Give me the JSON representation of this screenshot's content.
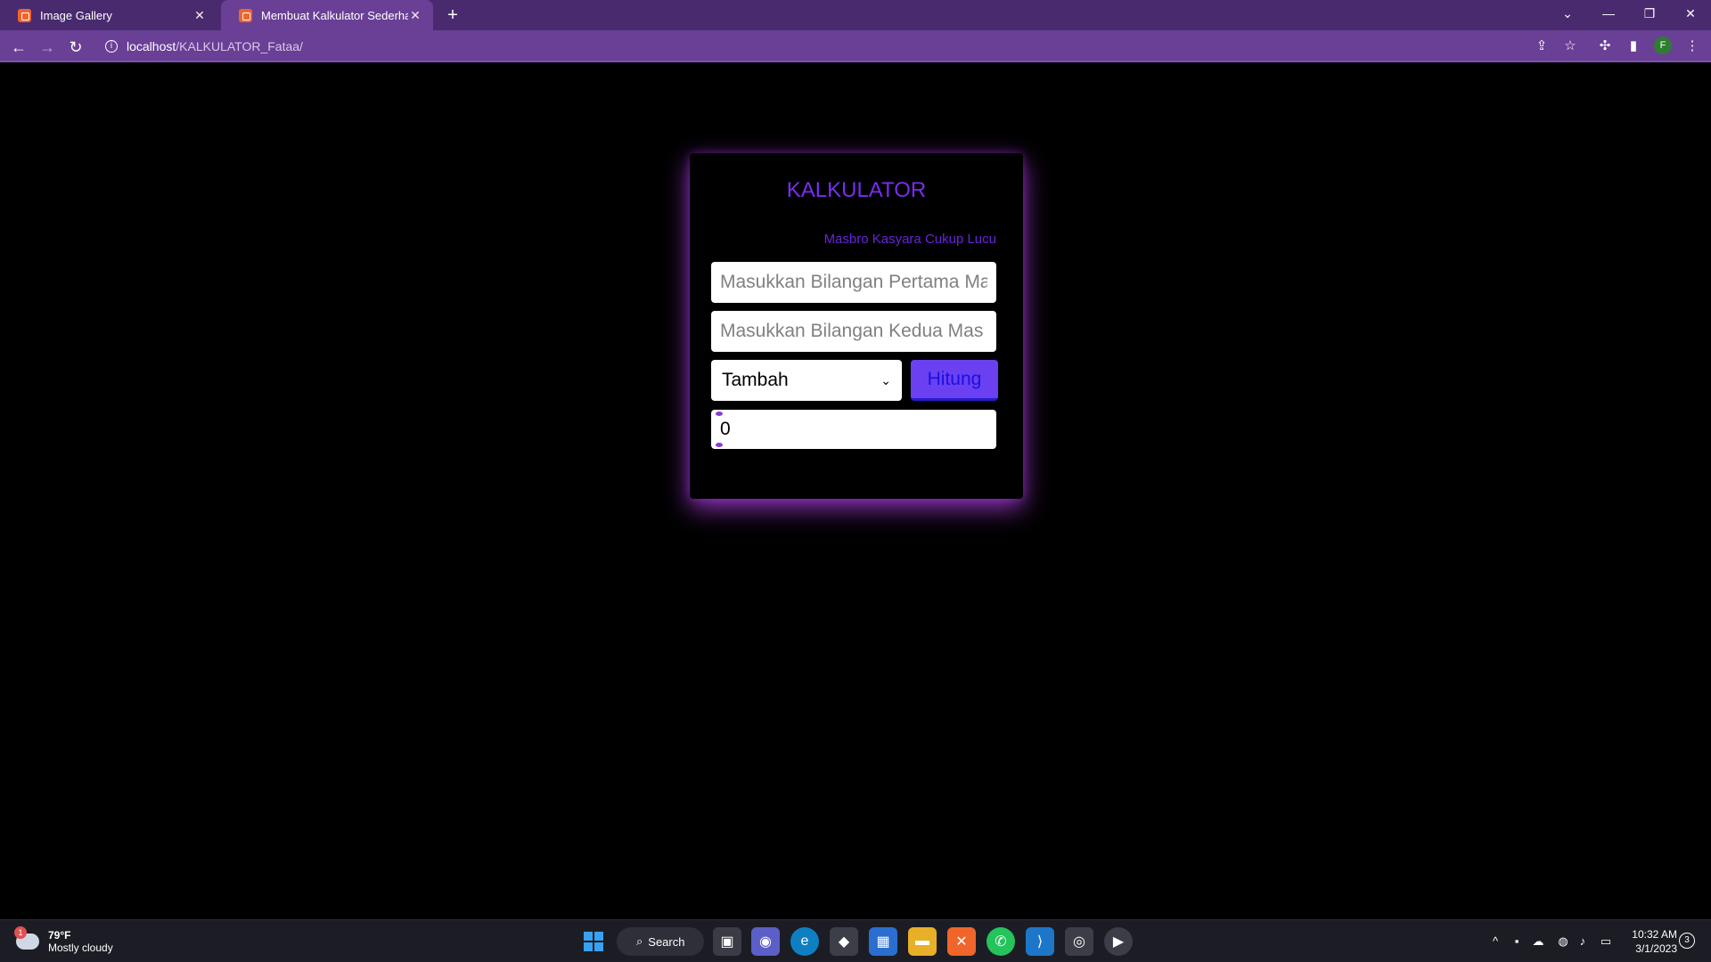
{
  "browser": {
    "tabs": [
      {
        "title": "Image Gallery",
        "active": false
      },
      {
        "title": "Membuat Kalkulator Sederhana I",
        "active": true
      }
    ],
    "new_tab_icon": "plus-icon",
    "url_host": "localhost",
    "url_path": "/KALKULATOR_Fataa/",
    "profile_initial": "F"
  },
  "calculator": {
    "title": "KALKULATOR",
    "subtitle": "Masbro Kasyara Cukup Lucu",
    "first_placeholder": "Masukkan Bilangan Pertama Ma",
    "second_placeholder": "Masukkan Bilangan Kedua Mas",
    "operation_selected": "Tambah",
    "button_label": "Hitung",
    "result_value": "0"
  },
  "colors": {
    "accent": "#7a2cf0",
    "button": "#6a40f0",
    "glow": "#a83cdc",
    "chrome": "#6a3f96"
  },
  "taskbar": {
    "weather_temp": "79°F",
    "weather_desc": "Mostly cloudy",
    "weather_badge": "1",
    "search_label": "Search",
    "time": "10:32 AM",
    "date": "3/1/2023",
    "notification_count": "3"
  }
}
